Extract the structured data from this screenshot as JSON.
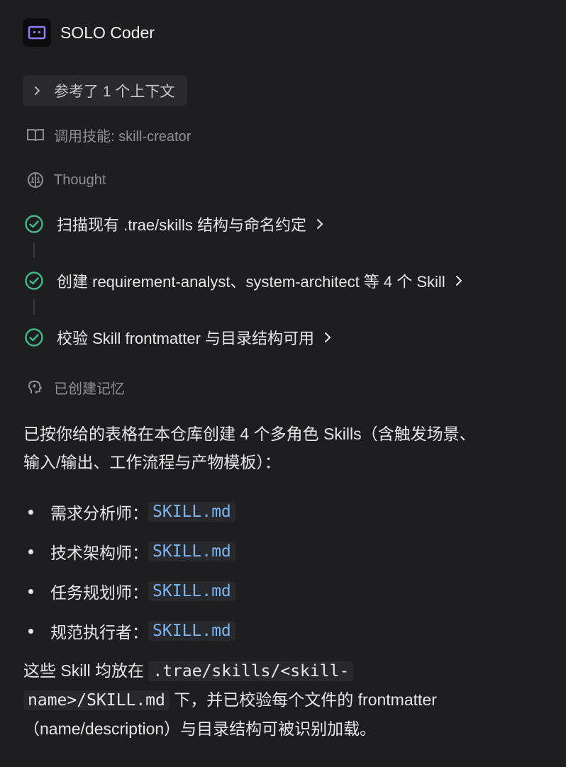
{
  "header": {
    "title": "SOLO Coder",
    "icon": "robot-face-icon",
    "accent": "#8e7cf0"
  },
  "context_chip": {
    "label": "参考了 1 个上下文"
  },
  "skill_call": {
    "label": "调用技能: skill-creator",
    "icon": "book-icon"
  },
  "thought": {
    "label": "Thought",
    "icon": "brain-icon"
  },
  "steps": [
    {
      "label": "扫描现有 .trae/skills 结构与命名约定",
      "status": "done"
    },
    {
      "label": "创建 requirement-analyst、system-architect 等 4 个 Skill",
      "status": "done"
    },
    {
      "label": "校验 Skill frontmatter 与目录结构可用",
      "status": "done"
    }
  ],
  "memory": {
    "label": "已创建记忆",
    "icon": "memory-icon"
  },
  "message": {
    "intro_line1": "已按你给的表格在本仓库创建 4 个多角色 Skills（含触发场景、",
    "intro_line2": "输入/输出、工作流程与产物模板）：",
    "items": [
      {
        "role": "需求分析师：",
        "file": "SKILL.md"
      },
      {
        "role": "技术架构师：",
        "file": "SKILL.md"
      },
      {
        "role": "任务规划师：",
        "file": "SKILL.md"
      },
      {
        "role": "规范执行者：",
        "file": "SKILL.md"
      }
    ],
    "outro_prefix": "这些 Skill 均放在 ",
    "outro_code_line1": ".trae/skills/<skill-",
    "outro_code_line2": "name>/SKILL.md",
    "outro_mid": " 下，并已校验每个文件的 frontmatter",
    "outro_line3": "（name/description）与目录结构可被识别加载。"
  },
  "colors": {
    "check_green": "#3fb889",
    "link_blue": "#77b6f2",
    "muted": "#8f8f94"
  }
}
